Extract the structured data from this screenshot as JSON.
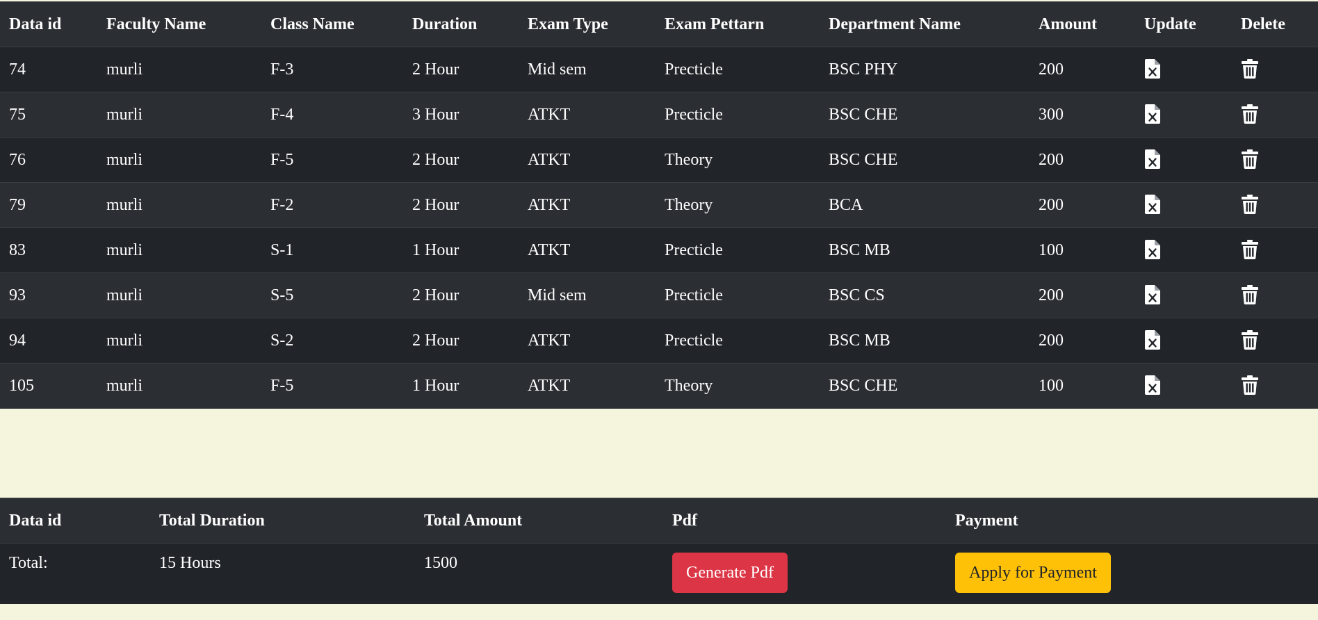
{
  "main_table": {
    "headers": [
      "Data id",
      "Faculty Name",
      "Class Name",
      "Duration",
      "Exam Type",
      "Exam Pettarn",
      "Department Name",
      "Amount",
      "Update",
      "Delete"
    ],
    "rows": [
      [
        "74",
        "murli",
        "F-3",
        "2 Hour",
        "Mid sem",
        "Precticle",
        "BSC PHY",
        "200"
      ],
      [
        "75",
        "murli",
        "F-4",
        "3 Hour",
        "ATKT",
        "Precticle",
        "BSC CHE",
        "300"
      ],
      [
        "76",
        "murli",
        "F-5",
        "2 Hour",
        "ATKT",
        "Theory",
        "BSC CHE",
        "200"
      ],
      [
        "79",
        "murli",
        "F-2",
        "2 Hour",
        "ATKT",
        "Theory",
        "BCA",
        "200"
      ],
      [
        "83",
        "murli",
        "S-1",
        "1 Hour",
        "ATKT",
        "Precticle",
        "BSC MB",
        "100"
      ],
      [
        "93",
        "murli",
        "S-5",
        "2 Hour",
        "Mid sem",
        "Precticle",
        "BSC CS",
        "200"
      ],
      [
        "94",
        "murli",
        "S-2",
        "2 Hour",
        "ATKT",
        "Precticle",
        "BSC MB",
        "200"
      ],
      [
        "105",
        "murli",
        "F-5",
        "1 Hour",
        "ATKT",
        "Theory",
        "BSC CHE",
        "100"
      ]
    ],
    "update_icon": "file-excel-icon",
    "delete_icon": "trash-icon"
  },
  "summary_table": {
    "headers": [
      "Data id",
      "Total Duration",
      "Total Amount",
      "Pdf",
      "Payment"
    ],
    "total_label": "Total:",
    "total_duration": "15 Hours",
    "total_amount": "1500",
    "pdf_button_label": "Generate Pdf",
    "payment_button_label": "Apply for Payment"
  },
  "colors": {
    "page_background": "#f5f4dc",
    "header_row": "#2b2e33",
    "row_dark": "#212429",
    "row_light": "#2b2e33",
    "pdf_button": "#dc3545",
    "payment_button": "#ffc107"
  }
}
